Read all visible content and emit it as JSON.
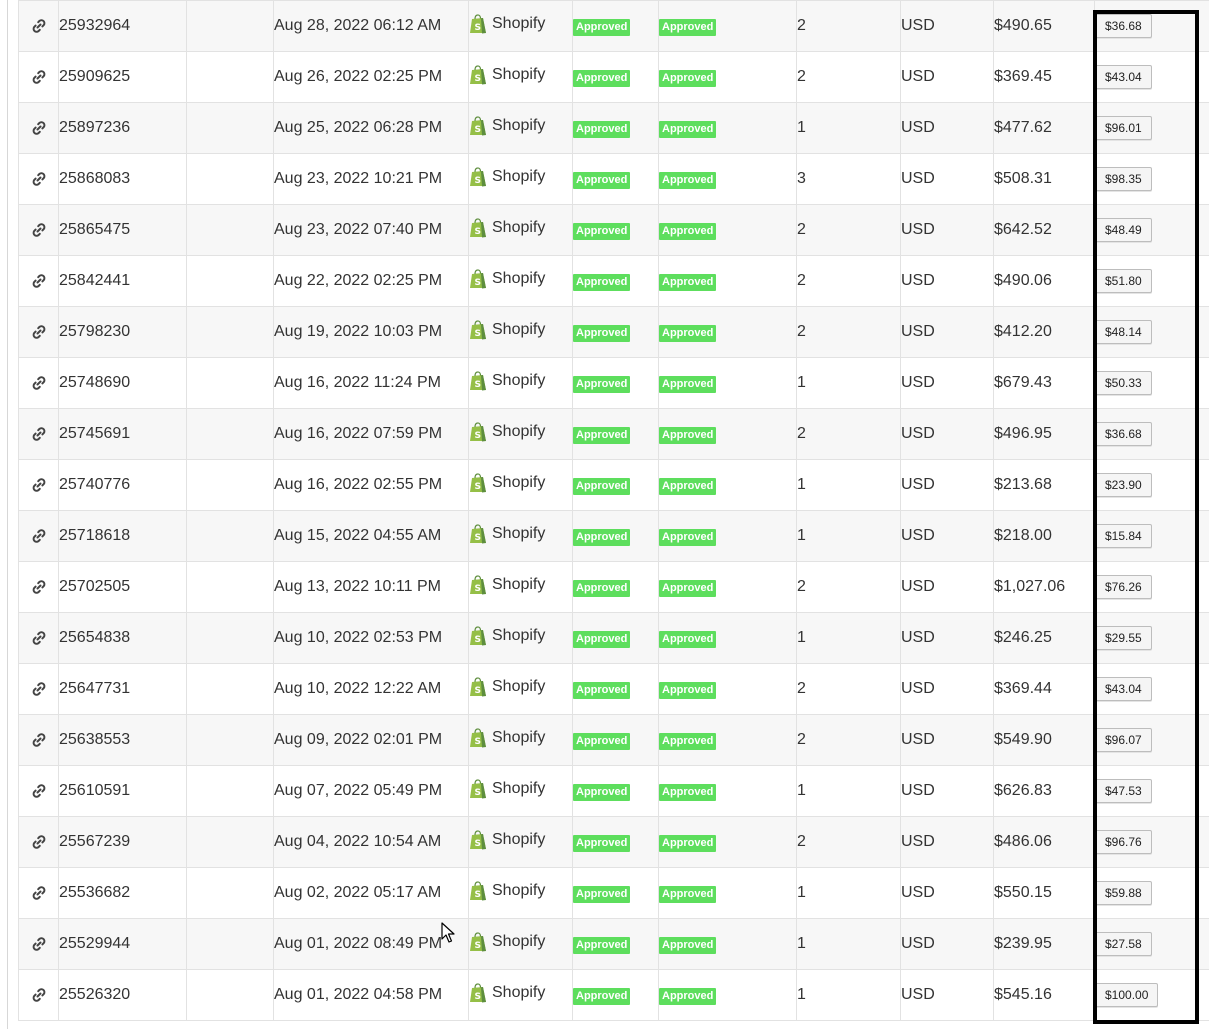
{
  "platform_name": "Shopify",
  "status_label_1": "Approved",
  "status_label_2": "Approved",
  "colors": {
    "badge": "#5dde5d",
    "shopify_green": "#95bf47",
    "highlight_border": "#000000"
  },
  "icons": {
    "link": "link-icon",
    "platform": "shopify-bag-icon",
    "cursor": "mouse-cursor-icon"
  },
  "rows": [
    {
      "id": "25932964",
      "date": "Aug 28, 2022 06:12 AM",
      "qty": "2",
      "currency": "USD",
      "total": "$490.65",
      "commission": "$36.68"
    },
    {
      "id": "25909625",
      "date": "Aug 26, 2022 02:25 PM",
      "qty": "2",
      "currency": "USD",
      "total": "$369.45",
      "commission": "$43.04"
    },
    {
      "id": "25897236",
      "date": "Aug 25, 2022 06:28 PM",
      "qty": "1",
      "currency": "USD",
      "total": "$477.62",
      "commission": "$96.01"
    },
    {
      "id": "25868083",
      "date": "Aug 23, 2022 10:21 PM",
      "qty": "3",
      "currency": "USD",
      "total": "$508.31",
      "commission": "$98.35"
    },
    {
      "id": "25865475",
      "date": "Aug 23, 2022 07:40 PM",
      "qty": "2",
      "currency": "USD",
      "total": "$642.52",
      "commission": "$48.49"
    },
    {
      "id": "25842441",
      "date": "Aug 22, 2022 02:25 PM",
      "qty": "2",
      "currency": "USD",
      "total": "$490.06",
      "commission": "$51.80"
    },
    {
      "id": "25798230",
      "date": "Aug 19, 2022 10:03 PM",
      "qty": "2",
      "currency": "USD",
      "total": "$412.20",
      "commission": "$48.14"
    },
    {
      "id": "25748690",
      "date": "Aug 16, 2022 11:24 PM",
      "qty": "1",
      "currency": "USD",
      "total": "$679.43",
      "commission": "$50.33"
    },
    {
      "id": "25745691",
      "date": "Aug 16, 2022 07:59 PM",
      "qty": "2",
      "currency": "USD",
      "total": "$496.95",
      "commission": "$36.68"
    },
    {
      "id": "25740776",
      "date": "Aug 16, 2022 02:55 PM",
      "qty": "1",
      "currency": "USD",
      "total": "$213.68",
      "commission": "$23.90"
    },
    {
      "id": "25718618",
      "date": "Aug 15, 2022 04:55 AM",
      "qty": "1",
      "currency": "USD",
      "total": "$218.00",
      "commission": "$15.84"
    },
    {
      "id": "25702505",
      "date": "Aug 13, 2022 10:11 PM",
      "qty": "2",
      "currency": "USD",
      "total": "$1,027.06",
      "commission": "$76.26"
    },
    {
      "id": "25654838",
      "date": "Aug 10, 2022 02:53 PM",
      "qty": "1",
      "currency": "USD",
      "total": "$246.25",
      "commission": "$29.55"
    },
    {
      "id": "25647731",
      "date": "Aug 10, 2022 12:22 AM",
      "qty": "2",
      "currency": "USD",
      "total": "$369.44",
      "commission": "$43.04"
    },
    {
      "id": "25638553",
      "date": "Aug 09, 2022 02:01 PM",
      "qty": "2",
      "currency": "USD",
      "total": "$549.90",
      "commission": "$96.07"
    },
    {
      "id": "25610591",
      "date": "Aug 07, 2022 05:49 PM",
      "qty": "1",
      "currency": "USD",
      "total": "$626.83",
      "commission": "$47.53"
    },
    {
      "id": "25567239",
      "date": "Aug 04, 2022 10:54 AM",
      "qty": "2",
      "currency": "USD",
      "total": "$486.06",
      "commission": "$96.76"
    },
    {
      "id": "25536682",
      "date": "Aug 02, 2022 05:17 AM",
      "qty": "1",
      "currency": "USD",
      "total": "$550.15",
      "commission": "$59.88"
    },
    {
      "id": "25529944",
      "date": "Aug 01, 2022 08:49 PM",
      "qty": "1",
      "currency": "USD",
      "total": "$239.95",
      "commission": "$27.58"
    },
    {
      "id": "25526320",
      "date": "Aug 01, 2022 04:58 PM",
      "qty": "1",
      "currency": "USD",
      "total": "$545.16",
      "commission": "$100.00"
    }
  ]
}
